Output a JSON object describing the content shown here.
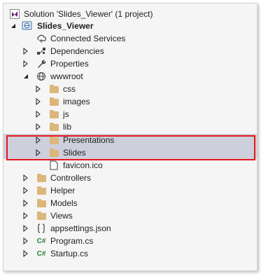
{
  "tree": {
    "solution": {
      "label": "Solution 'Slides_Viewer' (1 project)",
      "icon": "visual-studio-solution-icon"
    },
    "project": {
      "label": "Slides_Viewer",
      "icon": "web-project-icon"
    },
    "items": {
      "connected_services": {
        "label": "Connected Services",
        "icon": "connected-services-icon"
      },
      "dependencies": {
        "label": "Dependencies",
        "icon": "dependencies-icon"
      },
      "properties": {
        "label": "Properties",
        "icon": "wrench-icon"
      },
      "wwwroot": {
        "label": "wwwroot",
        "icon": "globe-icon"
      },
      "css": {
        "label": "css",
        "icon": "folder-icon"
      },
      "images": {
        "label": "images",
        "icon": "folder-icon"
      },
      "js": {
        "label": "js",
        "icon": "folder-icon"
      },
      "lib": {
        "label": "lib",
        "icon": "folder-icon"
      },
      "presentations": {
        "label": "Presentations",
        "icon": "folder-icon"
      },
      "slides": {
        "label": "Slides",
        "icon": "folder-icon"
      },
      "favicon": {
        "label": "favicon.ico",
        "icon": "file-icon"
      },
      "controllers": {
        "label": "Controllers",
        "icon": "folder-icon"
      },
      "helper": {
        "label": "Helper",
        "icon": "folder-icon"
      },
      "models": {
        "label": "Models",
        "icon": "folder-icon"
      },
      "views": {
        "label": "Views",
        "icon": "folder-icon"
      },
      "appsettings": {
        "label": "appsettings.json",
        "icon": "json-file-icon"
      },
      "program": {
        "label": "Program.cs",
        "icon": "csharp-file-icon"
      },
      "startup": {
        "label": "Startup.cs",
        "icon": "csharp-file-icon"
      }
    },
    "csharp_glyph": "C#"
  },
  "colors": {
    "panel_bg": "#f5f5f5",
    "selection_bg": "#cdd0dc",
    "highlight_border": "#e8151b",
    "folder": "#dcb67a"
  }
}
